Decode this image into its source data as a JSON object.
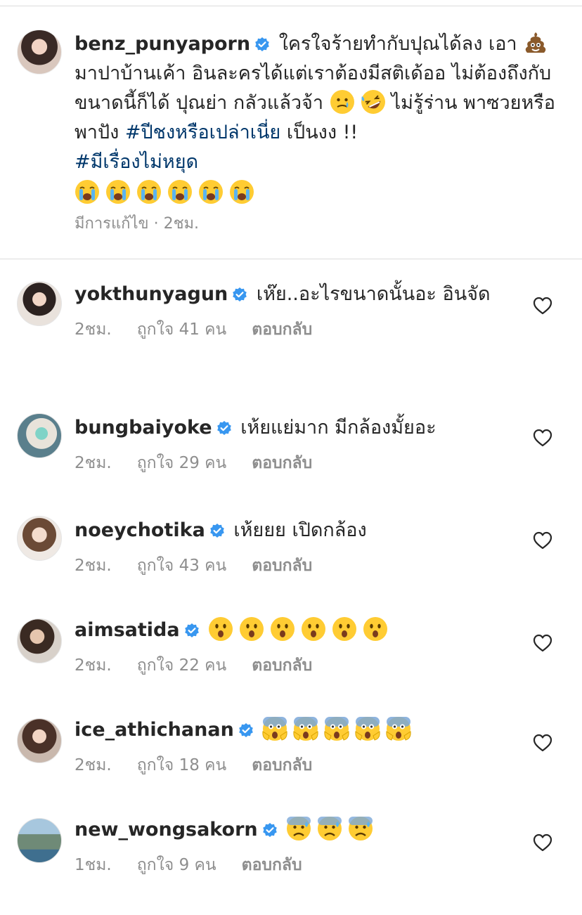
{
  "caption": {
    "username": "benz_punyaporn",
    "text_1": "ใครใจร้ายทำกับปุณได้ลง เอา",
    "text_2": " มาปาบ้านเค้า อินละครได้แต่เราต้องมีสติเด้ออ ไม่ต้องถึงกับขนาดนี้ก็ได้  ปุณย่า กลัวแล้วจ้า ",
    "text_3": "ไม่รู้ร่าน พาซวยหรือพาปัง  ",
    "hashtag_1": "#ปีชงหรือเปล่าเนี่ย",
    "text_4": " เป็นงง !!",
    "hashtag_2": "#มีเรื่องไม่หยุด",
    "meta": "มีการแก้ไข · 2ชม.",
    "icons": [
      "poop-emoji",
      "tear-smile-emoji",
      "rofl-emoji",
      "crying-emoji"
    ]
  },
  "comments": [
    {
      "username": "yokthunyagun",
      "text": "เห๊ย..อะไรขนาดนั้นอะ อินจัด",
      "time": "2ชม.",
      "likes": "ถูกใจ 41 คน",
      "reply": "ตอบกลับ"
    },
    {
      "username": "bungbaiyoke",
      "text": "เห้ยแย่มาก มีกล้องมั้ยอะ",
      "time": "2ชม.",
      "likes": "ถูกใจ 29 คน",
      "reply": "ตอบกลับ"
    },
    {
      "username": "noeychotika",
      "text": "เห้ยยย เปิดกล้อง",
      "time": "2ชม.",
      "likes": "ถูกใจ 43 คน",
      "reply": "ตอบกลับ"
    },
    {
      "username": "aimsatida",
      "text": "",
      "emoji": "surprised-emoji",
      "emoji_count": 6,
      "time": "2ชม.",
      "likes": "ถูกใจ 22 คน",
      "reply": "ตอบกลับ"
    },
    {
      "username": "ice_athichanan",
      "text": "",
      "emoji": "scream-emoji",
      "emoji_count": 5,
      "time": "2ชม.",
      "likes": "ถูกใจ 18 คน",
      "reply": "ตอบกลับ"
    },
    {
      "username": "new_wongsakorn",
      "text": "",
      "emoji": "anxious-sweat-emoji",
      "emoji_count": 3,
      "time": "1ชม.",
      "likes": "ถูกใจ 9 คน",
      "reply": "ตอบกลับ"
    }
  ],
  "colors": {
    "verified": "#3897f0",
    "hashtag": "#00376b",
    "meta": "#8e8e8e",
    "divider": "#dbdbdb",
    "emoji_yellow": "#ffcc33"
  }
}
